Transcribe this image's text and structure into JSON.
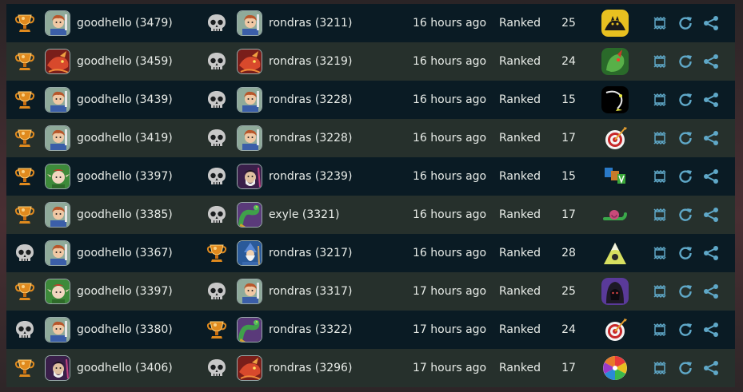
{
  "colors": {
    "row_dark": "#0a1b24",
    "row_light": "#26302c",
    "text": "#e8ece8",
    "action_blue": "#5fa8c8",
    "trophy_orange": "#e08a1e",
    "skull_grey": "#c8c8c8"
  },
  "icons": {
    "win": "trophy-icon",
    "loss": "skull-icon",
    "replay": "replay-icon",
    "restart": "rematch-icon",
    "share": "share-icon"
  },
  "matches": [
    {
      "p1_result": "win",
      "p1_avatar": "human",
      "p1": "goodhello (3479)",
      "p2_result": "loss",
      "p2_avatar": "human",
      "p2": "rondras (3211)",
      "time": "16 hours ago",
      "mode": "Ranked",
      "turns": "25",
      "deck": "night"
    },
    {
      "p1_result": "win",
      "p1_avatar": "dragon",
      "p1": "goodhello (3459)",
      "p2_result": "loss",
      "p2_avatar": "dragon",
      "p2": "rondras (3219)",
      "time": "16 hours ago",
      "mode": "Ranked",
      "turns": "24",
      "deck": "dragon-green"
    },
    {
      "p1_result": "win",
      "p1_avatar": "human",
      "p1": "goodhello (3439)",
      "p2_result": "loss",
      "p2_avatar": "human",
      "p2": "rondras (3228)",
      "time": "16 hours ago",
      "mode": "Ranked",
      "turns": "15",
      "deck": "spark"
    },
    {
      "p1_result": "win",
      "p1_avatar": "human",
      "p1": "goodhello (3419)",
      "p2_result": "loss",
      "p2_avatar": "human",
      "p2": "rondras (3228)",
      "time": "16 hours ago",
      "mode": "Ranked",
      "turns": "17",
      "deck": "target"
    },
    {
      "p1_result": "win",
      "p1_avatar": "elf",
      "p1": "goodhello (3397)",
      "p2_result": "loss",
      "p2_avatar": "mage",
      "p2": "rondras (3239)",
      "time": "16 hours ago",
      "mode": "Ranked",
      "turns": "15",
      "deck": "blocks"
    },
    {
      "p1_result": "win",
      "p1_avatar": "human",
      "p1": "goodhello (3385)",
      "p2_result": "loss",
      "p2_avatar": "serpent",
      "p2": "exyle (3321)",
      "time": "16 hours ago",
      "mode": "Ranked",
      "turns": "17",
      "deck": "snail"
    },
    {
      "p1_result": "loss",
      "p1_avatar": "human",
      "p1": "goodhello (3367)",
      "p2_result": "win",
      "p2_avatar": "wizard",
      "p2": "rondras (3217)",
      "time": "16 hours ago",
      "mode": "Ranked",
      "turns": "28",
      "deck": "mountain"
    },
    {
      "p1_result": "win",
      "p1_avatar": "elf",
      "p1": "goodhello (3397)",
      "p2_result": "loss",
      "p2_avatar": "human",
      "p2": "rondras (3317)",
      "time": "17 hours ago",
      "mode": "Ranked",
      "turns": "25",
      "deck": "hood"
    },
    {
      "p1_result": "loss",
      "p1_avatar": "human",
      "p1": "goodhello (3380)",
      "p2_result": "win",
      "p2_avatar": "serpent",
      "p2": "rondras (3322)",
      "time": "17 hours ago",
      "mode": "Ranked",
      "turns": "24",
      "deck": "target"
    },
    {
      "p1_result": "win",
      "p1_avatar": "mage",
      "p1": "goodhello (3406)",
      "p2_result": "loss",
      "p2_avatar": "dragon",
      "p2": "rondras (3296)",
      "time": "17 hours ago",
      "mode": "Ranked",
      "turns": "17",
      "deck": "wheel"
    }
  ]
}
